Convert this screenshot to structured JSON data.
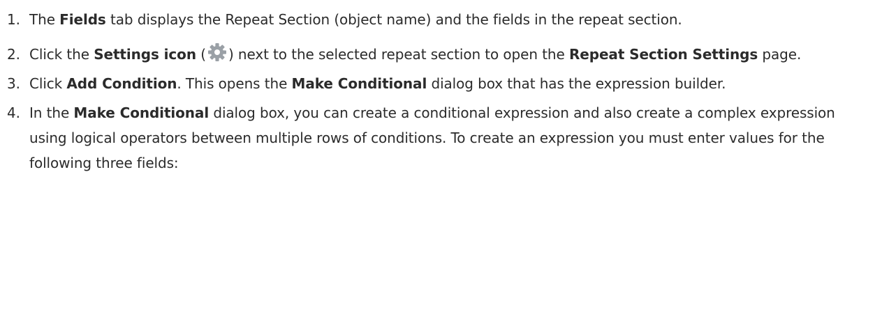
{
  "steps": [
    {
      "num": "1.",
      "parts": [
        "The ",
        "Fields",
        " tab displays the Repeat Section (object name) and the fields in the repeat section."
      ]
    },
    {
      "num": "2.",
      "parts": [
        "Click the ",
        "Settings icon",
        " (",
        ") next to the selected repeat section to open the ",
        "Repeat Section Settings",
        " page."
      ],
      "icon": "gear-icon"
    },
    {
      "num": "3.",
      "parts": [
        "Click ",
        "Add Condition",
        ". This opens the ",
        "Make Conditional",
        " dialog box that has the expression builder."
      ]
    },
    {
      "num": "4.",
      "parts": [
        "In the ",
        "Make Conditional",
        " dialog box, you can create a conditional expression and also create a complex expression using logical operators between multiple rows of conditions. To create an expression you must enter values for the following three fields:"
      ]
    }
  ],
  "colors": {
    "text": "#2b2b2b",
    "icon": "#9aa0a6"
  }
}
